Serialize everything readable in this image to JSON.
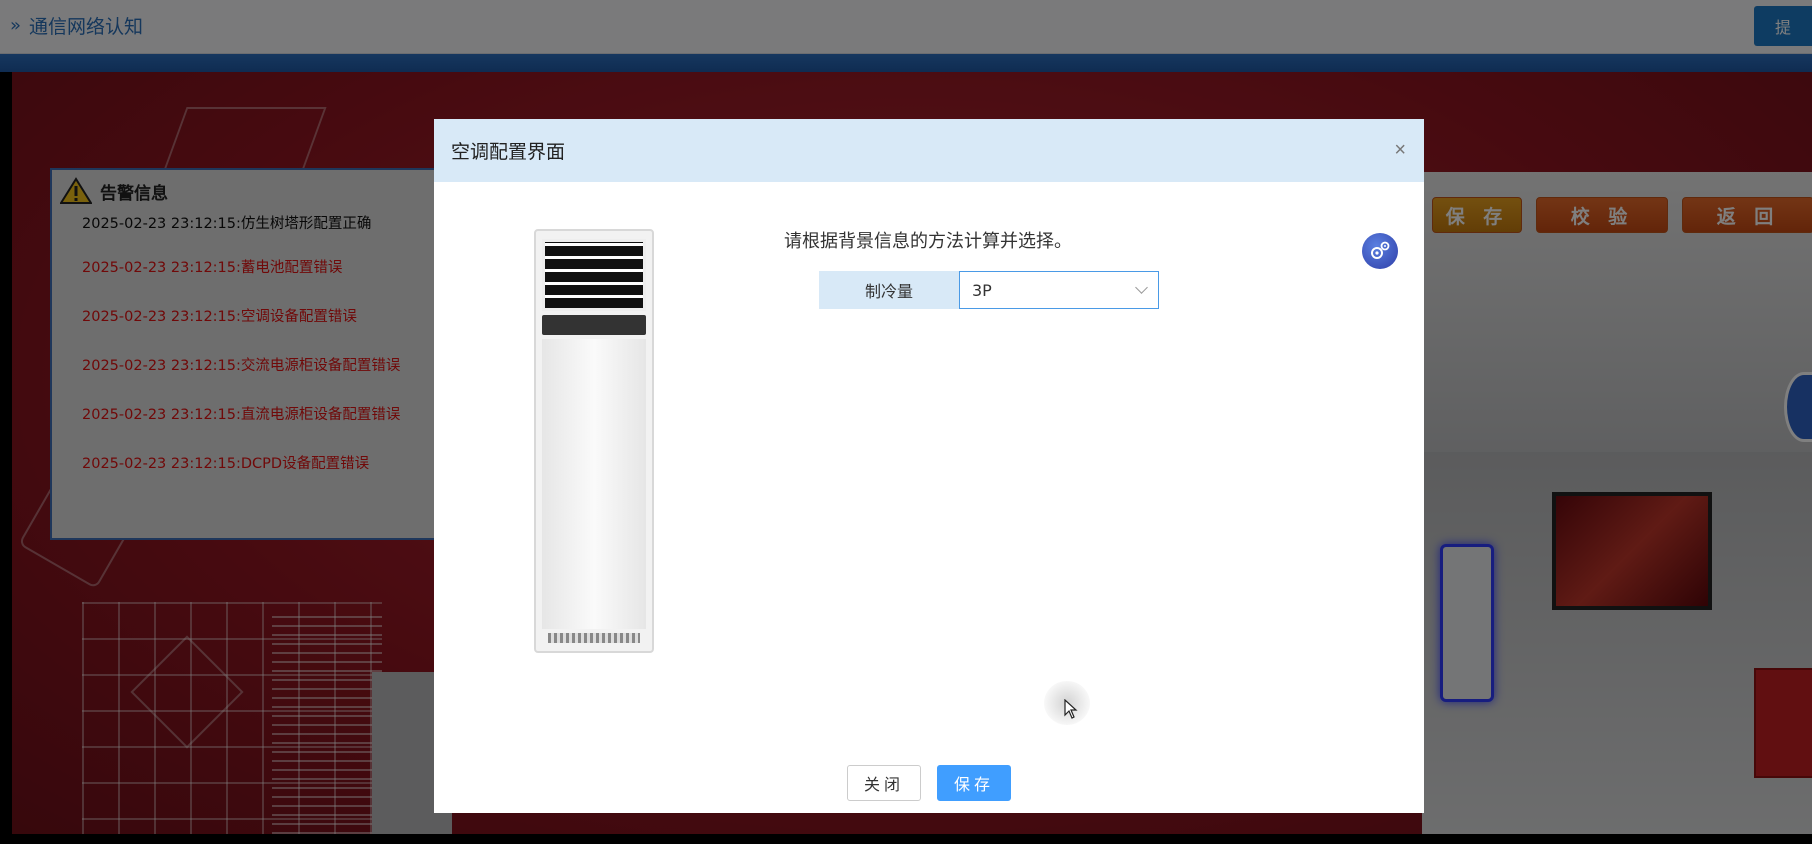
{
  "header": {
    "title": "通信网络认知",
    "submit_label": "提"
  },
  "scene": {
    "buttons": [
      "保 存",
      "校 验",
      "返 回"
    ]
  },
  "alarm": {
    "title": "告警信息",
    "items": [
      {
        "text": "2025-02-23 23:12:15:仿生树塔形配置正确",
        "status": "ok"
      },
      {
        "text": "2025-02-23 23:12:15:蓄电池配置错误",
        "status": "error"
      },
      {
        "text": "2025-02-23 23:12:15:空调设备配置错误",
        "status": "error"
      },
      {
        "text": "2025-02-23 23:12:15:交流电源柜设备配置错误",
        "status": "error"
      },
      {
        "text": "2025-02-23 23:12:15:直流电源柜设备配置错误",
        "status": "error"
      },
      {
        "text": "2025-02-23 23:12:15:DCPD设备配置错误",
        "status": "error"
      }
    ]
  },
  "modal": {
    "title": "空调配置界面",
    "close_symbol": "×",
    "instruction": "请根据背景信息的方法计算并选择。",
    "field_label": "制冷量",
    "field_value": "3P",
    "cancel_label": "关闭",
    "save_label": "保存"
  },
  "colors": {
    "primary": "#409eff",
    "header_bg": "#d8e9f7",
    "error_text": "#e01212",
    "scene_red": "#9a1a25"
  }
}
